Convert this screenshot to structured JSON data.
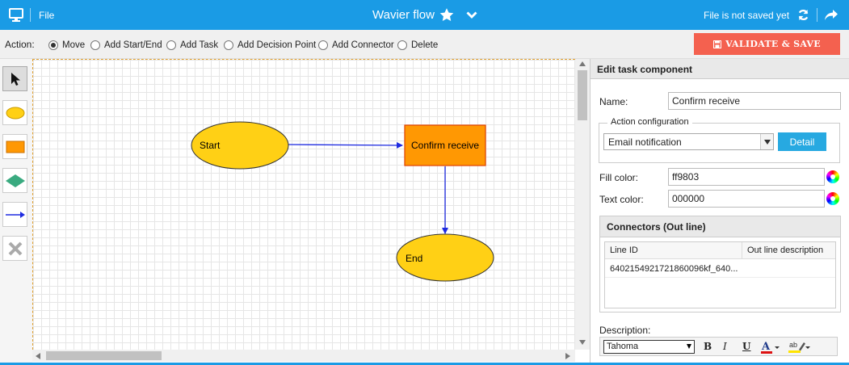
{
  "topbar": {
    "file_label": "File",
    "title": "Wavier flow",
    "status": "File is not saved yet",
    "icons": [
      "monitor-icon",
      "star-icon",
      "chevron-down-icon",
      "refresh-icon",
      "share-icon"
    ]
  },
  "actionbar": {
    "label": "Action:",
    "options": [
      "Move",
      "Add Start/End",
      "Add Task",
      "Add Decision Point",
      "Add Connector",
      "Delete"
    ],
    "selected": "Move",
    "validate_label": "VALIDATE & SAVE"
  },
  "toolbox": {
    "tools": [
      "pointer-tool",
      "ellipse-tool",
      "rectangle-tool",
      "diamond-tool",
      "connector-tool",
      "delete-tool"
    ]
  },
  "diagram": {
    "nodes": [
      {
        "id": "start",
        "label": "Start",
        "shape": "ellipse",
        "fill": "#ffd015"
      },
      {
        "id": "task",
        "label": "Confirm receive",
        "shape": "rect",
        "fill": "#ff9803"
      },
      {
        "id": "end",
        "label": "End",
        "shape": "ellipse",
        "fill": "#ffd015"
      }
    ],
    "edges": [
      {
        "from": "start",
        "to": "task"
      },
      {
        "from": "task",
        "to": "end"
      }
    ],
    "edge_color": "#1e2be0"
  },
  "panel": {
    "title": "Edit task component",
    "name_label": "Name:",
    "name_value": "Confirm receive",
    "action_legend": "Action configuration",
    "action_value": "Email notification",
    "detail_label": "Detail",
    "fill_label": "Fill color:",
    "fill_value": "ff9803",
    "text_label": "Text color:",
    "text_value": "000000",
    "connectors": {
      "title": "Connectors (Out line)",
      "columns": [
        "Line ID",
        "Out line description"
      ],
      "rows": [
        {
          "line_id": "640215492172186009​6kf_640...",
          "description": ""
        }
      ]
    },
    "description_label": "Description:",
    "font_value": "Tahoma",
    "rte_buttons": [
      "B",
      "I",
      "U"
    ]
  }
}
